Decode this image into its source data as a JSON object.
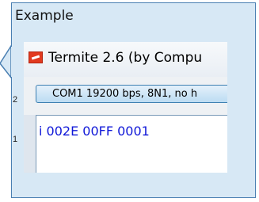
{
  "callout": {
    "label": "Example"
  },
  "terminal_window": {
    "title": "Termite 2.6 (by Compu",
    "port_settings": "COM1 19200 bps, 8N1, no h",
    "output_lines": [
      "i 002E 00FF 0001"
    ]
  },
  "colors": {
    "panel_fill": "#d7e8f5",
    "panel_border": "#4a7fb2",
    "output_text": "#1018d8",
    "app_icon": "#e23a1f"
  }
}
